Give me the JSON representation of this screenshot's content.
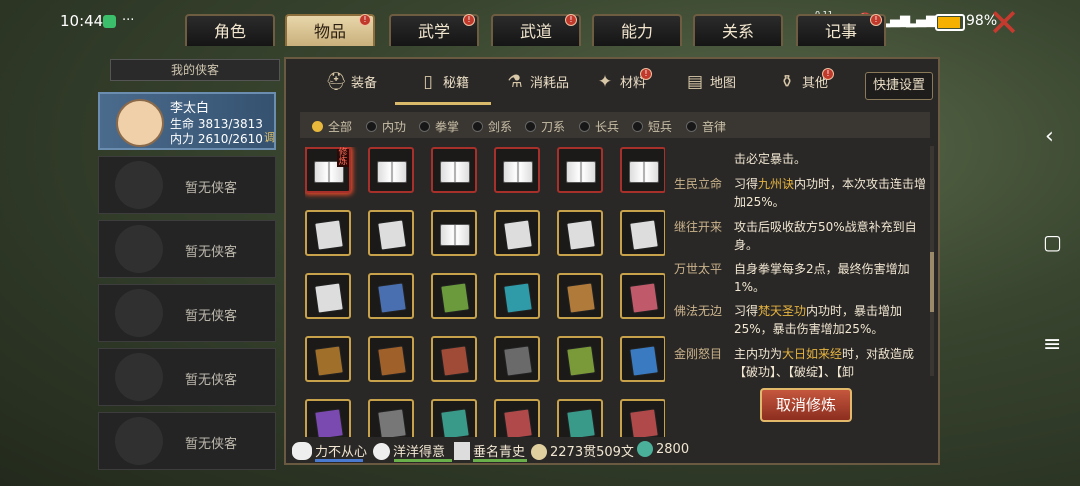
{
  "status_bar": {
    "time": "10:44",
    "dots": "···",
    "net_speed": "0.11\nKB/s",
    "battery_pct": "98%",
    "battery_level": 0.98
  },
  "top_tabs": [
    {
      "label": "角色",
      "active": false,
      "alert": false
    },
    {
      "label": "物品",
      "active": true,
      "alert": true
    },
    {
      "label": "武学",
      "active": false,
      "alert": true
    },
    {
      "label": "武道",
      "active": false,
      "alert": true
    },
    {
      "label": "能力",
      "active": false,
      "alert": false
    },
    {
      "label": "关系",
      "active": false,
      "alert": false
    },
    {
      "label": "记事",
      "active": false,
      "alert": true
    }
  ],
  "left_panel": {
    "header": "我的侠客",
    "character": {
      "name": "李太白",
      "hp": "生命 3813/3813",
      "mp": "内力 2610/2610",
      "tune": "调"
    },
    "empty_slot_label": "暂无侠客"
  },
  "sub_tabs": [
    {
      "label": "装备",
      "icon": "helmet-icon",
      "glyph": "⛑"
    },
    {
      "label": "秘籍",
      "icon": "scroll-icon",
      "glyph": "▯",
      "active": true
    },
    {
      "label": "消耗品",
      "icon": "potion-icon",
      "glyph": "⚗"
    },
    {
      "label": "材料",
      "icon": "material-icon",
      "glyph": "✦",
      "alert": true
    },
    {
      "label": "地图",
      "icon": "map-icon",
      "glyph": "▤"
    },
    {
      "label": "其他",
      "icon": "other-icon",
      "glyph": "⚱",
      "alert": true
    }
  ],
  "quick_settings": "快捷设置",
  "filters": [
    "全部",
    "内功",
    "拳掌",
    "剑系",
    "刀系",
    "长兵",
    "短兵",
    "音律"
  ],
  "grid_cultivate_tag": "修炼",
  "book_colors": {
    "row1": [
      "open",
      "open",
      "open",
      "open",
      "open",
      "open"
    ],
    "row2": [
      "#ddd",
      "#ddd",
      "open",
      "#ddd",
      "#ddd",
      "#ddd"
    ],
    "row3": [
      "#ddd",
      "#4a6fb0",
      "#6a9a3c",
      "#2f9aa8",
      "#b07a3a",
      "#c05a6a"
    ],
    "row4": [
      "#a0702a",
      "#a0602a",
      "#a04a38",
      "#6a6a6a",
      "#7a9a3a",
      "#3a7ac0"
    ],
    "row5": [
      "#7a4ab0",
      "#777",
      "#3a9a8a",
      "#b04a4a",
      "#3a9a8a",
      "#b04a4a"
    ]
  },
  "details": {
    "top_fragment": "击必定暴击。",
    "entries": [
      {
        "name": "生民立命",
        "pre": "习得",
        "hl": "九州诀",
        "post": "内功时，本次攻击连击增加25%。"
      },
      {
        "name": "继往开来",
        "pre": "攻击后吸收敌方50%战意补充到自身。",
        "hl": "",
        "post": ""
      },
      {
        "name": "万世太平",
        "pre": "自身拳掌每多2点，最终伤害增加1%。",
        "hl": "",
        "post": ""
      },
      {
        "name": "佛法无边",
        "pre": "习得",
        "hl": "梵天圣功",
        "post": "内功时，暴击增加25%，暴击伤害增加25%。"
      },
      {
        "name": "金刚怒目",
        "pre": "主内功为",
        "hl": "大日如来经",
        "post": "时，对敌造成【破功】、【破绽】、【卸"
      }
    ]
  },
  "cancel_button": "取消修炼",
  "bottom_bar": {
    "status1": "力不从心",
    "status2": "洋洋得意",
    "status3": "垂名青史",
    "money": "2273贯509文",
    "jade": "2800"
  },
  "android_nav": {
    "back": "‹",
    "home": "▢",
    "menu": "≡"
  }
}
